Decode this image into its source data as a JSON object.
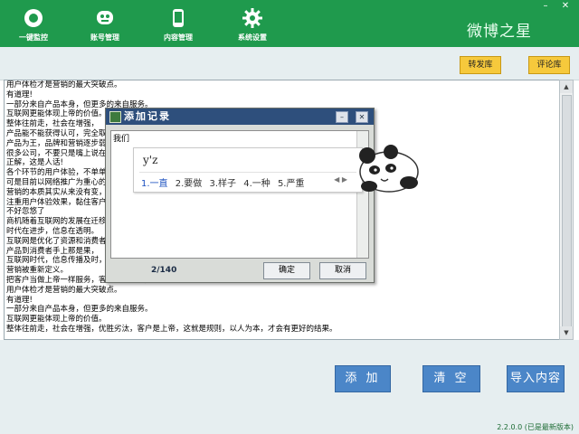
{
  "window": {
    "brand": "微博之星",
    "controls": {
      "minimize": "–",
      "close": "✕"
    }
  },
  "toolbar": {
    "items": [
      {
        "label": "一键監控",
        "icon": "monitor-icon"
      },
      {
        "label": "账号管理",
        "icon": "robot-account-icon"
      },
      {
        "label": "内容管理",
        "icon": "phone-content-icon"
      },
      {
        "label": "系统设置",
        "icon": "gear-icon"
      }
    ]
  },
  "libraries": {
    "repost": "转发库",
    "comment": "评论库"
  },
  "content_lines": [
    "用户体检才是营销的最大突破点。",
    "有道理!",
    "一部分来自产品本身，但更多的来自服务。",
    "互联网更能体现上帝的价值。",
    "整体往前走，社会在增强，",
    "产品能不能获得认可，完全取",
    "产品为王，品牌和营销逐步弱",
    "很多公司，不要只是嘴上说在",
    "正解，这是人话!",
    "各个环节的用户体验，不单单",
    "可是目前以网络推广为重心的",
    "营销的本质其实从来没有变，",
    "注重用户体验效果，黏住客户",
    "不好忽悠了",
    "商机随着互联网的发展在迁移",
    "时代在进步，信息在透明。",
    "互联网是优化了资源和消费者",
    "产品到消费者手上那是果，",
    "互联网时代，信息传播及时，",
    "营销被重新定义。",
    "把客户当做上帝一样服务，客户就会从你身上买",
    "用户体检才是营销的最大突破点。",
    "有道理!",
    "一部分来自产品本身，但更多的来自服务。",
    "互联网更能体现上帝的价值。",
    "整体往前走，社会在增强，优胜劣汰，客户是上帝，这就是规则，以人为本，才会有更好的结果。"
  ],
  "actions": {
    "add": "添 加",
    "clear": "清 空",
    "import": "导入内容"
  },
  "version": "2.2.0.0 (已是最新版本)",
  "dialog": {
    "title": "添加记录",
    "controls": {
      "minimize": "–",
      "close": "✕"
    },
    "input_text": "我们",
    "counter": "2/140",
    "ok": "确定",
    "cancel": "取消"
  },
  "ime": {
    "composition": "y'z",
    "candidates": [
      "1.一直",
      "2.要做",
      "3.样子",
      "4.一种",
      "5.严重"
    ],
    "nav": "◀ ▶"
  },
  "colors": {
    "toolbar_bg": "#1f9a4d",
    "library_button": "#f6c93c",
    "action_button": "#4b86c8",
    "dialog_title": "#2e4f7c"
  }
}
